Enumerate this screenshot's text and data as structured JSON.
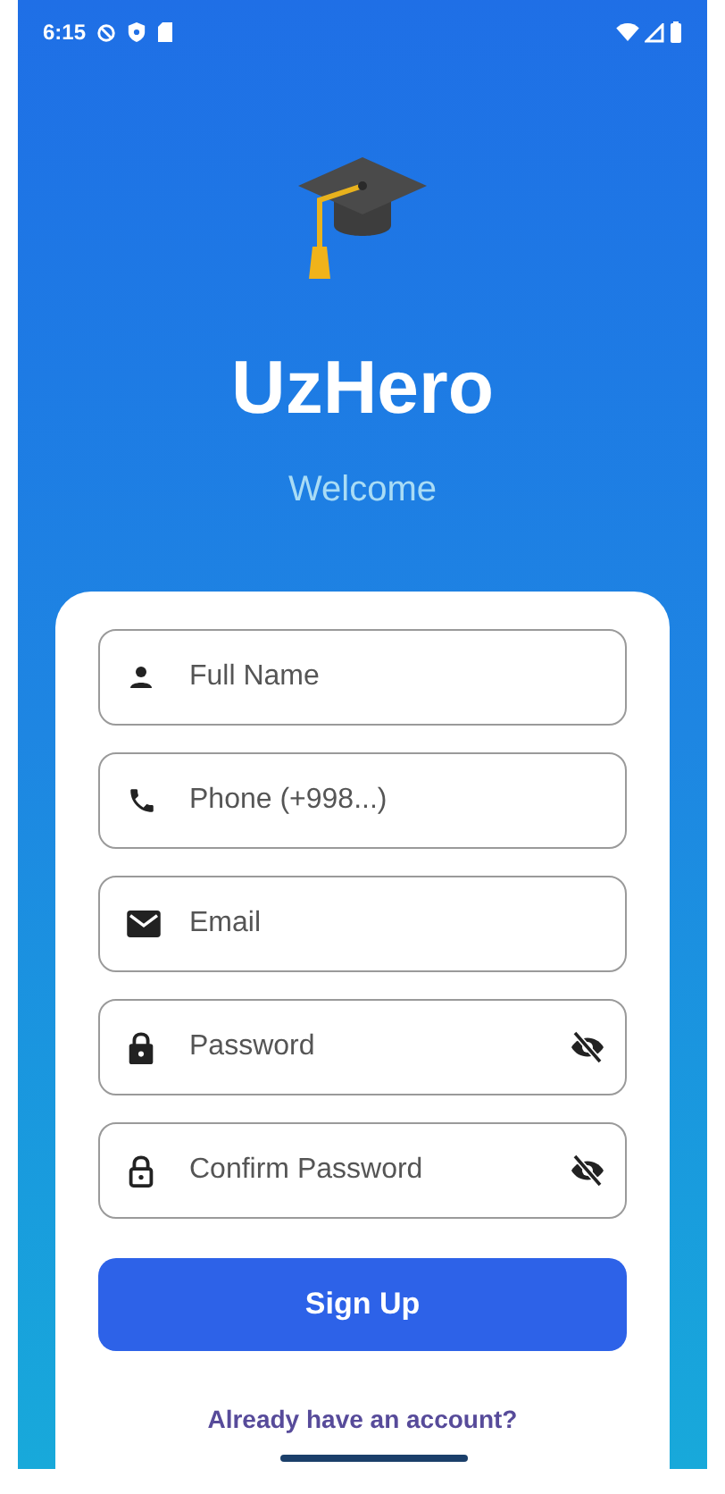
{
  "status_bar": {
    "time": "6:15"
  },
  "header": {
    "title": "UzHero",
    "subtitle": "Welcome"
  },
  "fields": [
    {
      "placeholder": "Full Name",
      "kind": "name"
    },
    {
      "placeholder": "Phone (+998...)",
      "kind": "phone"
    },
    {
      "placeholder": "Email",
      "kind": "email"
    },
    {
      "placeholder": "Password",
      "kind": "password"
    },
    {
      "placeholder": "Confirm Password",
      "kind": "confirm"
    }
  ],
  "primary_button": "Sign Up",
  "login_link": "Already have an account?"
}
